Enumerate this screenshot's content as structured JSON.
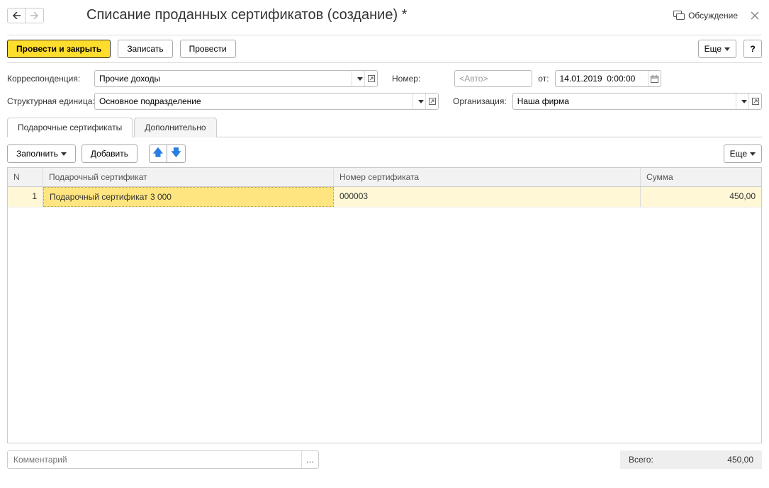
{
  "header": {
    "title": "Списание проданных сертификатов (создание) *",
    "discussion": "Обсуждение"
  },
  "commands": {
    "post_and_close": "Провести и закрыть",
    "write": "Записать",
    "post": "Провести",
    "more": "Еще",
    "help": "?"
  },
  "form": {
    "correspondence_label": "Корреспонденция:",
    "correspondence_value": "Прочие доходы",
    "number_label": "Номер:",
    "number_placeholder": "<Авто>",
    "from_label": "от:",
    "date_value": "14.01.2019  0:00:00",
    "unit_label": "Структурная единица:",
    "unit_value": "Основное подразделение",
    "org_label": "Организация:",
    "org_value": "Наша фирма"
  },
  "tabs": {
    "certificates": "Подарочные сертификаты",
    "additional": "Дополнительно"
  },
  "table_toolbar": {
    "fill": "Заполнить",
    "add": "Добавить",
    "more": "Еще"
  },
  "table": {
    "headers": {
      "n": "N",
      "certificate": "Подарочный сертификат",
      "cert_number": "Номер сертификата",
      "sum": "Сумма"
    },
    "rows": [
      {
        "n": "1",
        "certificate": "Подарочный сертификат 3 000",
        "cert_number": "000003",
        "sum": "450,00"
      }
    ]
  },
  "footer": {
    "comment_placeholder": "Комментарий",
    "total_label": "Всего:",
    "total_value": "450,00"
  }
}
